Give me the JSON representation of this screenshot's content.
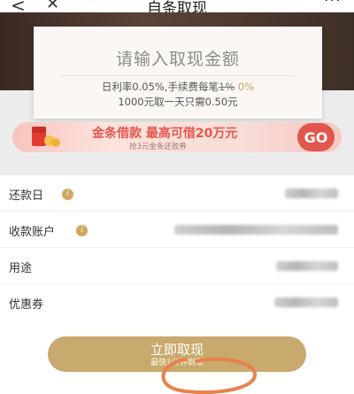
{
  "nav": {
    "back": "<",
    "close": "✕",
    "title": "自条取现",
    "more": "···"
  },
  "card": {
    "title": "请输入取现金额",
    "rate_prefix": "日利率0.05%,手续费每笔",
    "fee_old": "1%",
    "fee_new": "0%",
    "example": "1000元取一天只需0.50元"
  },
  "promo": {
    "title": "金条借款  最高可借20万元",
    "subtitle": "抢3元金条还款券",
    "go": "GO"
  },
  "form": {
    "rows": [
      {
        "label": "还款日"
      },
      {
        "label": "收款账户"
      },
      {
        "label": "用途"
      },
      {
        "label": "优惠券"
      }
    ]
  },
  "submit": {
    "label": "立即取现",
    "sub": "最快1分钟到账"
  },
  "colors": {
    "accent": "#c8a96e",
    "promo_red": "#e0564c",
    "banner_dark": "#4a3a30"
  }
}
